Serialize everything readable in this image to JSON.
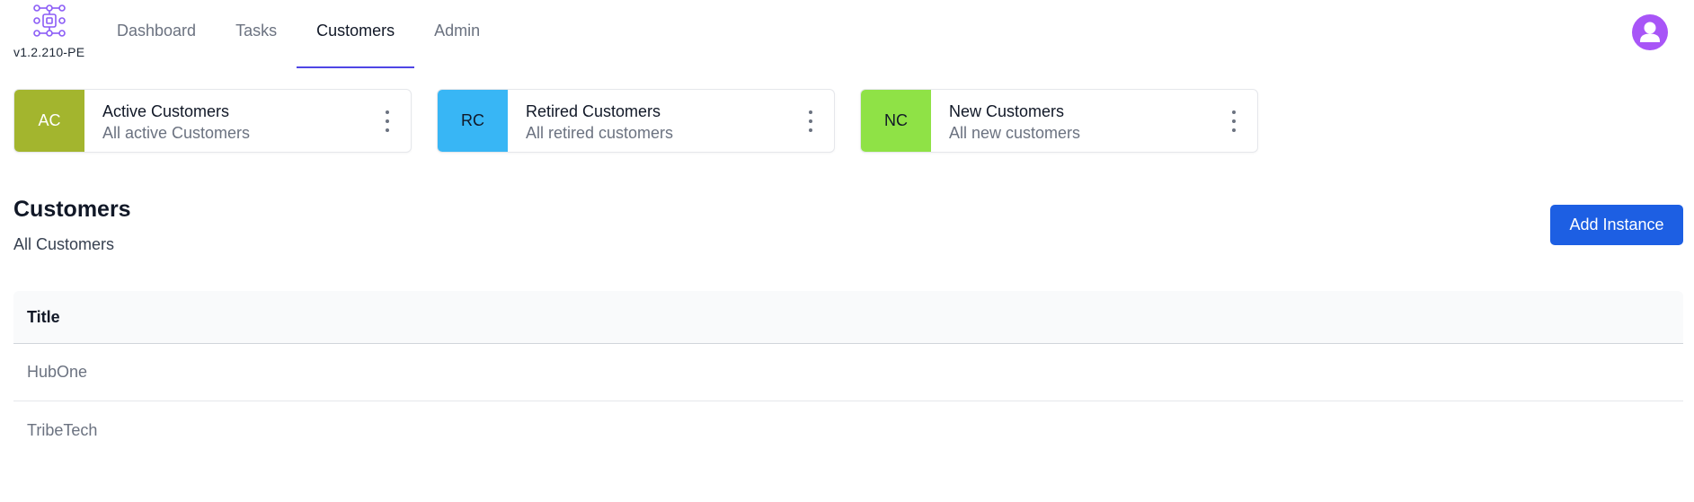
{
  "app": {
    "version": "v1.2.210-PE"
  },
  "nav": {
    "items": [
      {
        "label": "Dashboard"
      },
      {
        "label": "Tasks"
      },
      {
        "label": "Customers"
      },
      {
        "label": "Admin"
      }
    ],
    "active": "Customers"
  },
  "cards": [
    {
      "abbr": "AC",
      "title": "Active Customers",
      "subtitle": "All active Customers",
      "color": "#a3b52e",
      "text_color": "#ffffff"
    },
    {
      "abbr": "RC",
      "title": "Retired Customers",
      "subtitle": "All retired customers",
      "color": "#38b6f5",
      "text_color": "#111827"
    },
    {
      "abbr": "NC",
      "title": "New Customers",
      "subtitle": "All new customers",
      "color": "#8fe246",
      "text_color": "#111827"
    }
  ],
  "section": {
    "title": "Customers",
    "subtitle": "All Customers",
    "add_button": "Add Instance"
  },
  "table": {
    "columns": [
      "Title"
    ],
    "rows": [
      {
        "title": "HubOne"
      },
      {
        "title": "TribeTech"
      }
    ]
  },
  "colors": {
    "accent": "#4f46e5",
    "primary_button": "#1d5fe3",
    "avatar": "#a855f7",
    "logo": "#8b5cf6"
  },
  "icons": {
    "logo": "circuit-chip-icon",
    "avatar": "user-icon",
    "card_menu": "kebab-menu-icon"
  }
}
